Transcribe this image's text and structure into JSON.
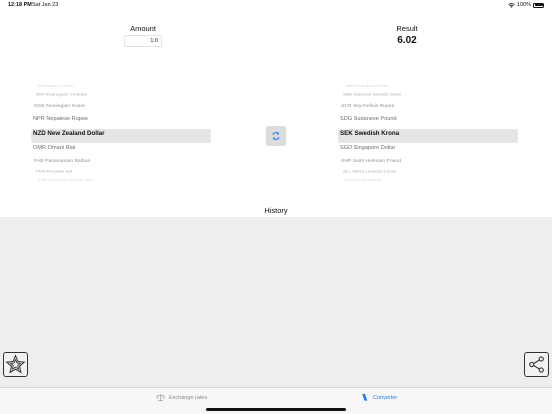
{
  "status_bar": {
    "time": "12:18 PM",
    "date": "Sat Jan 23",
    "battery": "100%",
    "battery_level": 1.0
  },
  "amount": {
    "label": "Amount",
    "value": "1.0"
  },
  "result": {
    "label": "Result",
    "value": "6.02"
  },
  "from_picker": {
    "items": [
      "NGN Nigerian Naira",
      "NIO Nicaraguan Cordoba",
      "NOK Norwegian Krone",
      "NPR Nepalese Rupee",
      "NZD New Zealand Dollar",
      "OMR Omani Rial",
      "PAB Panamanian Balboa",
      "PEN Peruvian Sol",
      "PGK Papua New Guinean Kina"
    ],
    "selected": "NZD New Zealand Dollar"
  },
  "to_picker": {
    "items": [
      "SAR Saudi Arabian Riyal",
      "SBD Solomon Islander Dollar",
      "SCR Seychellois Rupee",
      "SDG Sudanese Pound",
      "SEK Swedish Krona",
      "SGD Singapore Dollar",
      "SHP Saint Helenian Pound",
      "SLL Sierra Leonean Leone",
      "SOS Somali Shilling"
    ],
    "selected": "SEK Swedish Krona"
  },
  "history": {
    "title": "History"
  },
  "tabs": [
    {
      "label": "Exchange rates",
      "icon": "scale-icon",
      "active": false
    },
    {
      "label": "Converter",
      "icon": "converter-icon",
      "active": true
    }
  ],
  "colors": {
    "accent": "#1a7cf5",
    "picker_highlight": "#e6e6e6",
    "history_bg": "#eeeeee",
    "swap_icon": "#1a7cf5"
  }
}
